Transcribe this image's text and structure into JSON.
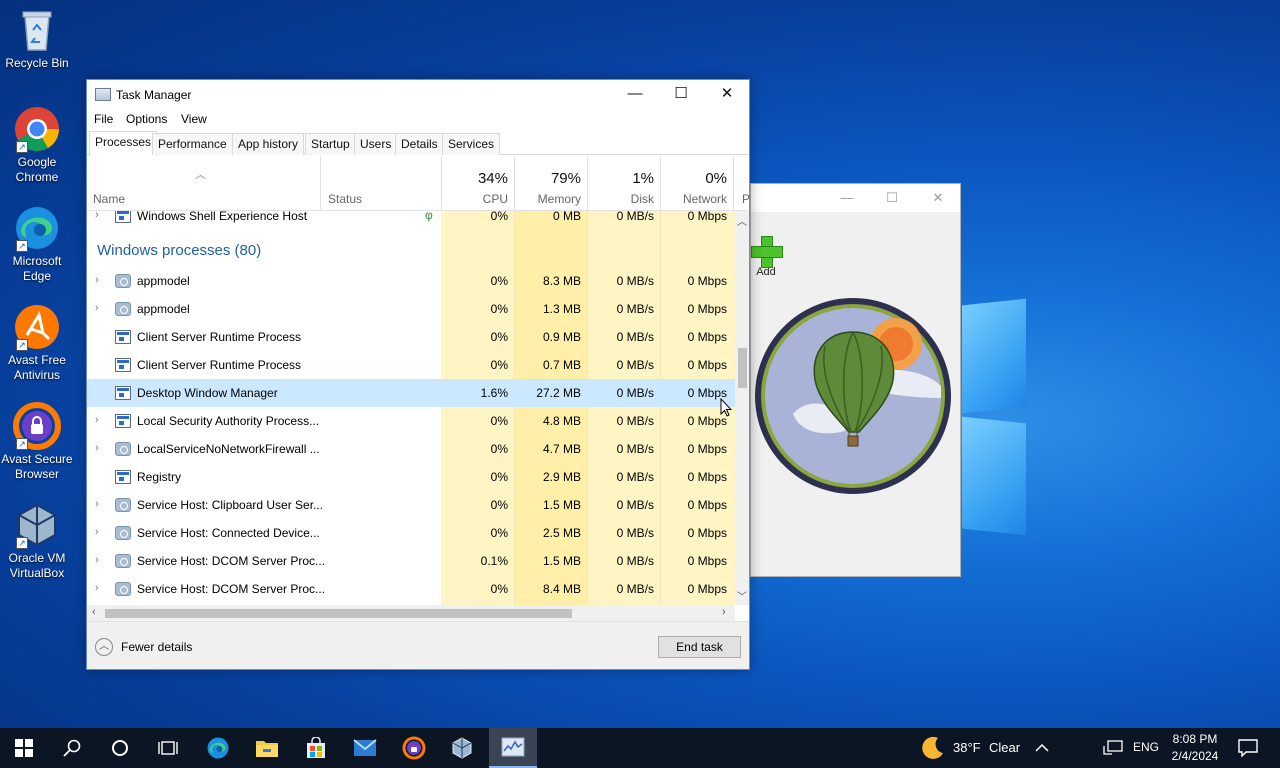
{
  "desktop": {
    "icons": [
      {
        "label": "Recycle Bin"
      },
      {
        "label": "Google Chrome"
      },
      {
        "label": "Microsoft Edge"
      },
      {
        "label": "Avast Free Antivirus"
      },
      {
        "label": "Avast Secure Browser"
      },
      {
        "label": "Oracle VM VirtualBox"
      }
    ]
  },
  "background_window": {
    "add_label": "Add",
    "minimize": "—",
    "maximize": "☐",
    "close": "✕"
  },
  "task_manager": {
    "title": "Task Manager",
    "caption": {
      "minimize": "—",
      "maximize": "☐",
      "close": "✕"
    },
    "menu": [
      "File",
      "Options",
      "View"
    ],
    "tabs": [
      "Processes",
      "Performance",
      "App history",
      "Startup",
      "Users",
      "Details",
      "Services"
    ],
    "active_tab": "Processes",
    "columns": {
      "name": "Name",
      "status": "Status",
      "cpu": {
        "pct": "34%",
        "label": "CPU"
      },
      "memory": {
        "pct": "79%",
        "label": "Memory"
      },
      "disk": {
        "pct": "1%",
        "label": "Disk"
      },
      "network": {
        "pct": "0%",
        "label": "Network"
      },
      "power_cut": "P"
    },
    "partial_row": {
      "name": "Windows Shell Experience Host",
      "cpu": "0%",
      "memory": "0 MB",
      "disk": "0 MB/s",
      "network": "0 Mbps"
    },
    "group_title": "Windows processes (80)",
    "rows": [
      {
        "name": "appmodel",
        "cpu": "0%",
        "memory": "8.3 MB",
        "disk": "0 MB/s",
        "network": "0 Mbps",
        "expandable": true,
        "icon": "gear"
      },
      {
        "name": "appmodel",
        "cpu": "0%",
        "memory": "1.3 MB",
        "disk": "0 MB/s",
        "network": "0 Mbps",
        "expandable": true,
        "icon": "gear"
      },
      {
        "name": "Client Server Runtime Process",
        "cpu": "0%",
        "memory": "0.9 MB",
        "disk": "0 MB/s",
        "network": "0 Mbps",
        "expandable": false,
        "icon": "win"
      },
      {
        "name": "Client Server Runtime Process",
        "cpu": "0%",
        "memory": "0.7 MB",
        "disk": "0 MB/s",
        "network": "0 Mbps",
        "expandable": false,
        "icon": "win"
      },
      {
        "name": "Desktop Window Manager",
        "cpu": "1.6%",
        "memory": "27.2 MB",
        "disk": "0 MB/s",
        "network": "0 Mbps",
        "expandable": false,
        "icon": "win",
        "selected": true
      },
      {
        "name": "Local Security Authority Process...",
        "cpu": "0%",
        "memory": "4.8 MB",
        "disk": "0 MB/s",
        "network": "0 Mbps",
        "expandable": true,
        "icon": "win"
      },
      {
        "name": "LocalServiceNoNetworkFirewall ...",
        "cpu": "0%",
        "memory": "4.7 MB",
        "disk": "0 MB/s",
        "network": "0 Mbps",
        "expandable": true,
        "icon": "gear"
      },
      {
        "name": "Registry",
        "cpu": "0%",
        "memory": "2.9 MB",
        "disk": "0 MB/s",
        "network": "0 Mbps",
        "expandable": false,
        "icon": "win"
      },
      {
        "name": "Service Host: Clipboard User Ser...",
        "cpu": "0%",
        "memory": "1.5 MB",
        "disk": "0 MB/s",
        "network": "0 Mbps",
        "expandable": true,
        "icon": "gear"
      },
      {
        "name": "Service Host: Connected Device...",
        "cpu": "0%",
        "memory": "2.5 MB",
        "disk": "0 MB/s",
        "network": "0 Mbps",
        "expandable": true,
        "icon": "gear"
      },
      {
        "name": "Service Host: DCOM Server Proc...",
        "cpu": "0.1%",
        "memory": "1.5 MB",
        "disk": "0 MB/s",
        "network": "0 Mbps",
        "expandable": true,
        "icon": "gear"
      },
      {
        "name": "Service Host: DCOM Server Proc...",
        "cpu": "0%",
        "memory": "8.4 MB",
        "disk": "0 MB/s",
        "network": "0 Mbps",
        "expandable": true,
        "icon": "gear"
      }
    ],
    "fewer_details": "Fewer details",
    "end_task": "End task"
  },
  "taskbar": {
    "weather_temp": "38°F",
    "weather_cond": "Clear",
    "language": "ENG",
    "time": "8:08 PM",
    "date": "2/4/2024"
  },
  "colors": {
    "accent": "#0078d7",
    "selection": "#cce8ff",
    "heat_light": "#fff4c4",
    "heat_mid": "#ffefa8",
    "group_text": "#1f5fa8"
  }
}
